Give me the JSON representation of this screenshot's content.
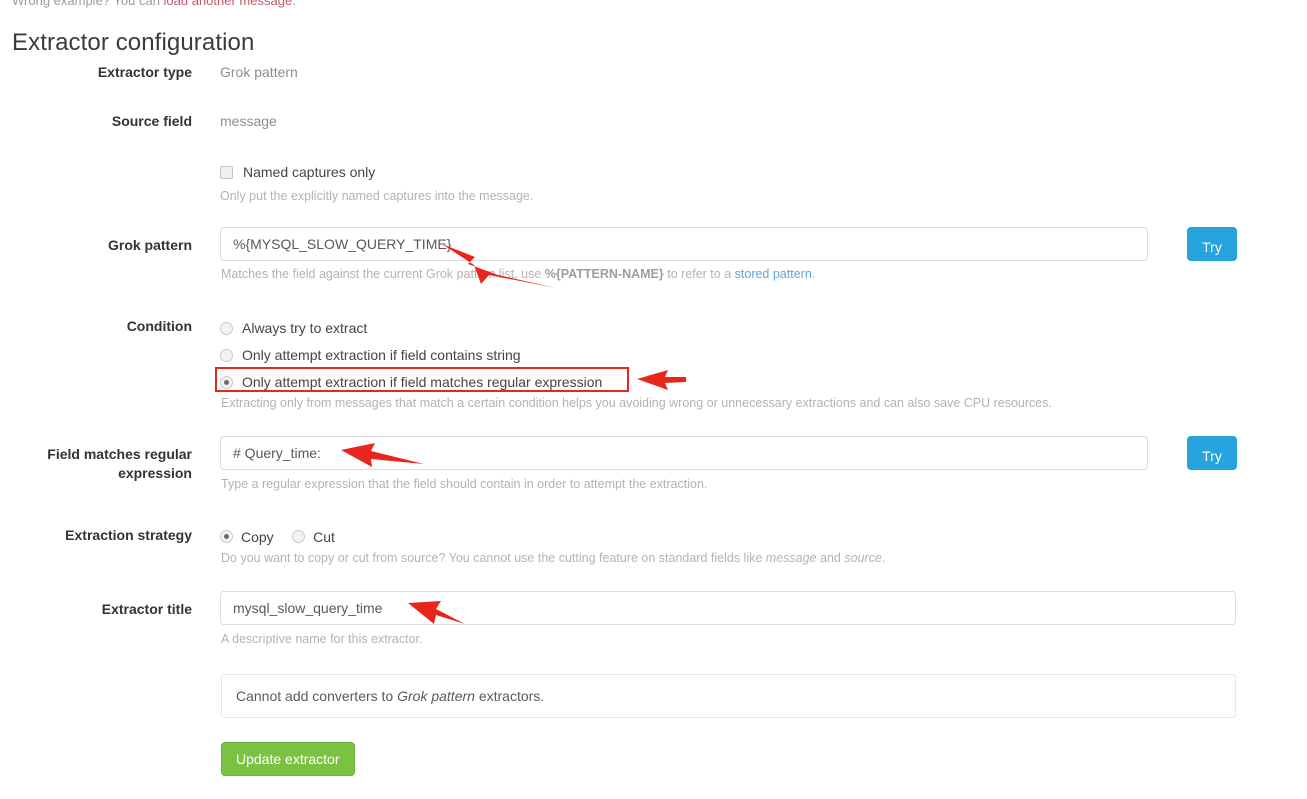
{
  "top_partial_notice": {
    "prefix": "Wrong example? You can ",
    "link": "load another message",
    "suffix": "."
  },
  "page": {
    "title": "Extractor configuration"
  },
  "fields": {
    "extractor_type": {
      "label": "Extractor type",
      "value": "Grok pattern"
    },
    "source_field": {
      "label": "Source field",
      "value": "message"
    },
    "named_captures": {
      "label": "Named captures only",
      "checked": false,
      "help": "Only put the explicitly named captures into the message."
    },
    "grok_pattern": {
      "label": "Grok pattern",
      "value": "%{MYSQL_SLOW_QUERY_TIME}",
      "placeholder": "",
      "try_label": "Try",
      "help_before": "Matches the field against the current Grok pattern list, use ",
      "help_bold": "%{PATTERN-NAME}",
      "help_middle": " to refer to a ",
      "help_link": "stored pattern",
      "help_after": "."
    },
    "condition": {
      "label": "Condition",
      "options": [
        {
          "label": "Always try to extract",
          "selected": false
        },
        {
          "label": "Only attempt extraction if field contains string",
          "selected": false
        },
        {
          "label": "Only attempt extraction if field matches regular expression",
          "selected": true
        }
      ],
      "help": "Extracting only from messages that match a certain condition helps you avoiding wrong or unnecessary extractions and can also save CPU resources."
    },
    "field_matches_regex": {
      "label_line1": "Field matches regular",
      "label_line2": "expression",
      "value": "# Query_time:",
      "try_label": "Try",
      "help": "Type a regular expression that the field should contain in order to attempt the extraction."
    },
    "extraction_strategy": {
      "label": "Extraction strategy",
      "options": [
        {
          "label": "Copy",
          "selected": true
        },
        {
          "label": "Cut",
          "selected": false
        }
      ],
      "help_before": "Do you want to copy or cut from source? You cannot use the cutting feature on standard fields like ",
      "help_italic1": "message",
      "help_middle": " and ",
      "help_italic2": "source",
      "help_after": "."
    },
    "extractor_title": {
      "label": "Extractor title",
      "value": "mysql_slow_query_time",
      "help": "A descriptive name for this extractor."
    }
  },
  "converters_notice": {
    "text_before": "Cannot add converters to ",
    "text_italic": "Grok pattern",
    "text_after": " extractors."
  },
  "submit": {
    "label": "Update extractor"
  },
  "annotations": {
    "arrow_color": "#e8261c",
    "highlight_color": "#e8261c",
    "arrows": [
      {
        "name": "arrow-to-grok-pattern"
      },
      {
        "name": "arrow-to-condition-regex-option"
      },
      {
        "name": "arrow-to-regex-field"
      },
      {
        "name": "arrow-to-extractor-title"
      }
    ]
  },
  "colors": {
    "try_button": "#26a4dd",
    "submit_button": "#7cc242",
    "link": "#5ba9dd"
  }
}
